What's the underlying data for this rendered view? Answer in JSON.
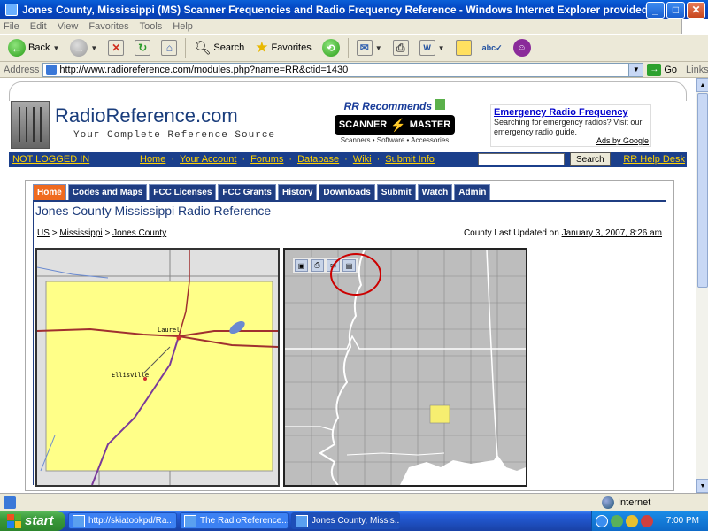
{
  "window": {
    "title": "Jones County, Mississippi (MS) Scanner Frequencies and Radio Frequency Reference - Windows Internet Explorer provided by Yahoo!",
    "minimize": "_",
    "maximize": "□",
    "close": "✕"
  },
  "menu": [
    "File",
    "Edit",
    "View",
    "Favorites",
    "Tools",
    "Help"
  ],
  "toolbar": {
    "back": "Back",
    "search": "Search",
    "favorites": "Favorites"
  },
  "address": {
    "label": "Address",
    "url": "http://www.radioreference.com/modules.php?name=RR&ctid=1430",
    "go": "Go",
    "links": "Links"
  },
  "site": {
    "brand": "RadioReference.com",
    "tagline": "Your Complete Reference Source",
    "recommends": "RR Recommends",
    "scanner_left": "SCANNER",
    "scanner_right": "MASTER",
    "scanner_sub": "Scanners • Software • Accessories",
    "ad": {
      "title": "Emergency Radio Frequency",
      "body": "Searching for emergency radios? Visit our emergency radio guide.",
      "by": "Ads by Google"
    }
  },
  "nav": {
    "login": "NOT LOGGED IN",
    "links": [
      "Home",
      "Your Account",
      "Forums",
      "Database",
      "Wiki",
      "Submit Info"
    ],
    "separator": "·",
    "search_button": "Search",
    "help": "RR Help Desk"
  },
  "tabs": [
    "Home",
    "Codes and Maps",
    "FCC Licenses",
    "FCC Grants",
    "History",
    "Downloads",
    "Submit",
    "Watch",
    "Admin"
  ],
  "content": {
    "title": "Jones County Mississippi Radio Reference",
    "breadcrumb": [
      "US",
      "Mississippi",
      "Jones County"
    ],
    "breadcrumb_sep": ">",
    "updated_label": "County Last Updated on",
    "updated_date": "January 3, 2007, 8:26 am"
  },
  "map": {
    "city1": "Laurel",
    "city2": "Ellisville"
  },
  "status": {
    "zone": "Internet"
  },
  "taskbar": {
    "start": "start",
    "tasks": [
      "http://skiatookpd/Ra...",
      "The RadioReference....",
      "Jones County, Missis..."
    ],
    "clock": "7:00 PM"
  },
  "colors": {
    "nav_bg": "#1b3f8b",
    "nav_link": "#ffd200",
    "tab_active": "#f06a1f",
    "tab_bg": "#1f3d82",
    "highlight_circle": "#cc0000",
    "county_fill": "#ffff88",
    "highlight_county": "#f6ee70"
  }
}
